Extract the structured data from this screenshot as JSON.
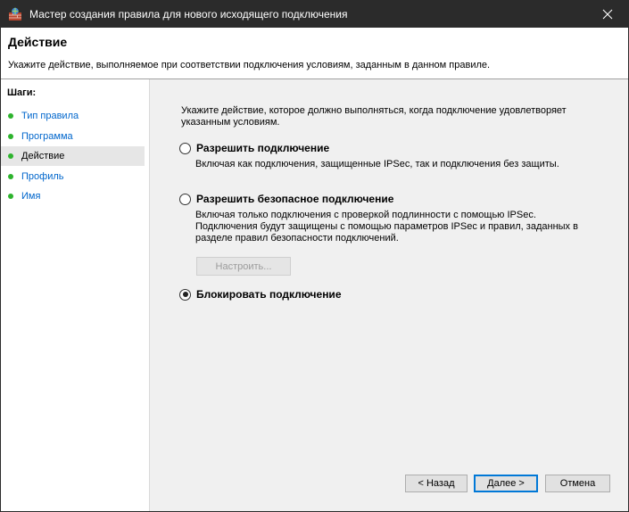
{
  "window": {
    "title": "Мастер создания правила для нового исходящего подключения",
    "close_symbol": "✕"
  },
  "header": {
    "title": "Действие",
    "description": "Укажите действие, выполняемое при соответствии подключения условиям, заданным в данном правиле."
  },
  "sidebar": {
    "steps_label": "Шаги:",
    "items": [
      {
        "label": "Тип правила",
        "active": false
      },
      {
        "label": "Программа",
        "active": false
      },
      {
        "label": "Действие",
        "active": true
      },
      {
        "label": "Профиль",
        "active": false
      },
      {
        "label": "Имя",
        "active": false
      }
    ]
  },
  "main": {
    "intro": "Укажите действие, которое должно выполняться, когда подключение удовлетворяет указанным условиям.",
    "options": [
      {
        "label": "Разрешить подключение",
        "description": "Включая как подключения, защищенные IPSec, так и подключения без защиты.",
        "checked": false
      },
      {
        "label": "Разрешить безопасное подключение",
        "description": "Включая только подключения с проверкой подлинности с помощью IPSec. Подключения будут защищены с помощью параметров IPSec и правил, заданных в разделе правил безопасности подключений.",
        "checked": false
      },
      {
        "label": "Блокировать подключение",
        "description": "",
        "checked": true
      }
    ],
    "configure_button": "Настроить..."
  },
  "footer": {
    "back": "< Назад",
    "next": "Далее >",
    "cancel": "Отмена"
  },
  "colors": {
    "titlebar": "#2b2b2b",
    "link": "#0066cc",
    "step_dot": "#2db32d",
    "accent": "#0078d7"
  }
}
